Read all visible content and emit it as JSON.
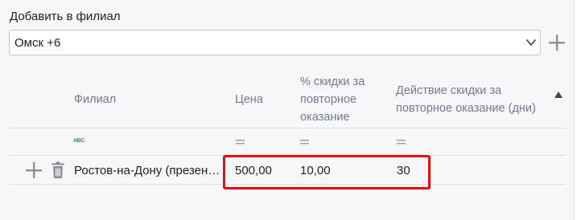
{
  "section": {
    "label": "Добавить в филиал"
  },
  "branch_select": {
    "value": "Омск +6",
    "chevron_icon": "chevron-down-icon",
    "add_icon": "plus-icon"
  },
  "table": {
    "columns": {
      "branch": "Филиал",
      "price": "Цена",
      "discount_percent": [
        "% скидки за",
        "повторное",
        "оказание"
      ],
      "discount_duration": [
        "Действие скидки за",
        "повторное оказание (дни)"
      ]
    },
    "filters": {
      "branch_icon": "abc-filter-icon",
      "price_icon": "equals-filter-icon",
      "discount_percent_icon": "equals-filter-icon",
      "discount_duration_icon": "equals-filter-icon"
    },
    "rows": [
      {
        "branch": "Ростов-на-Дону (презен…",
        "price": "500,00",
        "discount_percent": "10,00",
        "discount_duration": "30"
      }
    ]
  },
  "colors": {
    "highlight": "#e60d0d",
    "header_text": "#6f7c8e",
    "icon_grey": "#9a9a9f"
  }
}
